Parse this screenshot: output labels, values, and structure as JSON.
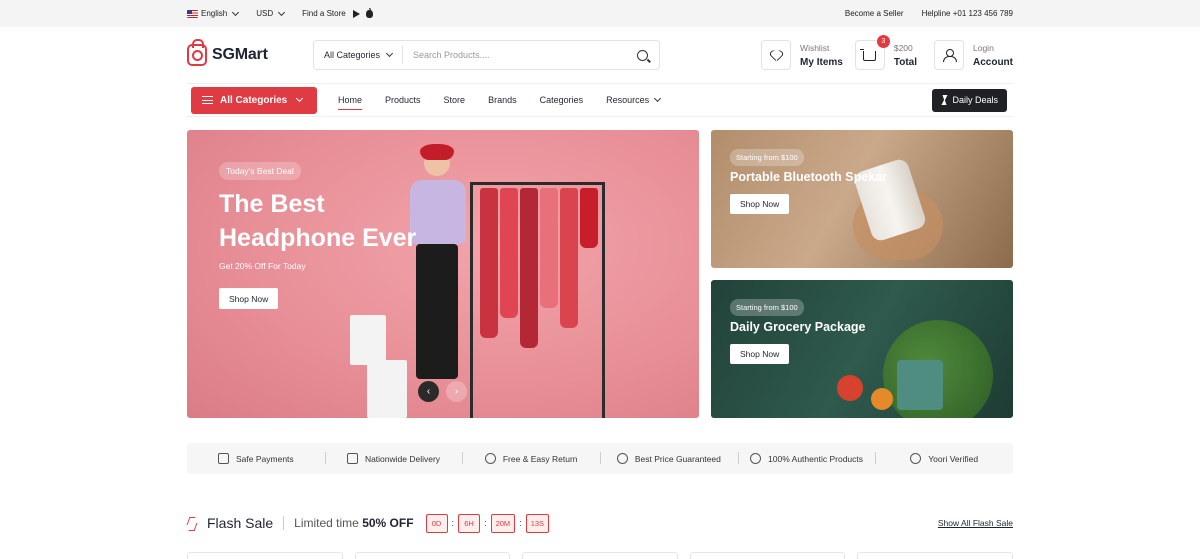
{
  "topbar": {
    "language": "English",
    "currency": "USD",
    "find_store": "Find a Store",
    "become_seller": "Become a Seller",
    "helpline": "Helpline +01 123 456 789"
  },
  "header": {
    "logo": "SGMart",
    "search_category": "All Categories",
    "search_placeholder": "Search Products....",
    "wishlist_small": "Wishlist",
    "wishlist_big": "My Items",
    "cart_count": "3",
    "cart_amount": "$200",
    "cart_label": "Total",
    "login_small": "Login",
    "login_big": "Account"
  },
  "nav": {
    "all_categories": "All Categories",
    "links": [
      "Home",
      "Products",
      "Store",
      "Brands",
      "Categories",
      "Resources"
    ],
    "daily_deals": "Daily Deals"
  },
  "hero": {
    "pill": "Today's Best Deal",
    "title": "The Best Headphone Ever",
    "subtitle": "Get 20% Off For Today",
    "cta": "Shop Now",
    "prev": "‹",
    "next": "›"
  },
  "promos": [
    {
      "pill": "Starting from $100",
      "title": "Portable Bluetooth Spekar",
      "cta": "Shop Now"
    },
    {
      "pill": "Starting from $100",
      "title": "Daily Grocery Package",
      "cta": "Shop Now"
    }
  ],
  "features": [
    "Safe Payments",
    "Nationwide Delivery",
    "Free & Easy Return",
    "Best Price Guaranteed",
    "100% Authentic Products",
    "Yoori Verified"
  ],
  "flash": {
    "title": "Flash Sale",
    "limited_prefix": "Limited time",
    "limited_offer": "50% OFF",
    "timer": [
      "0D",
      "6H",
      "20M",
      "13S"
    ],
    "show_all": "Show All Flash Sale"
  },
  "colors": {
    "accent": "#e03b43",
    "dark": "#1f2125",
    "hero_bg": "#e88f97"
  }
}
